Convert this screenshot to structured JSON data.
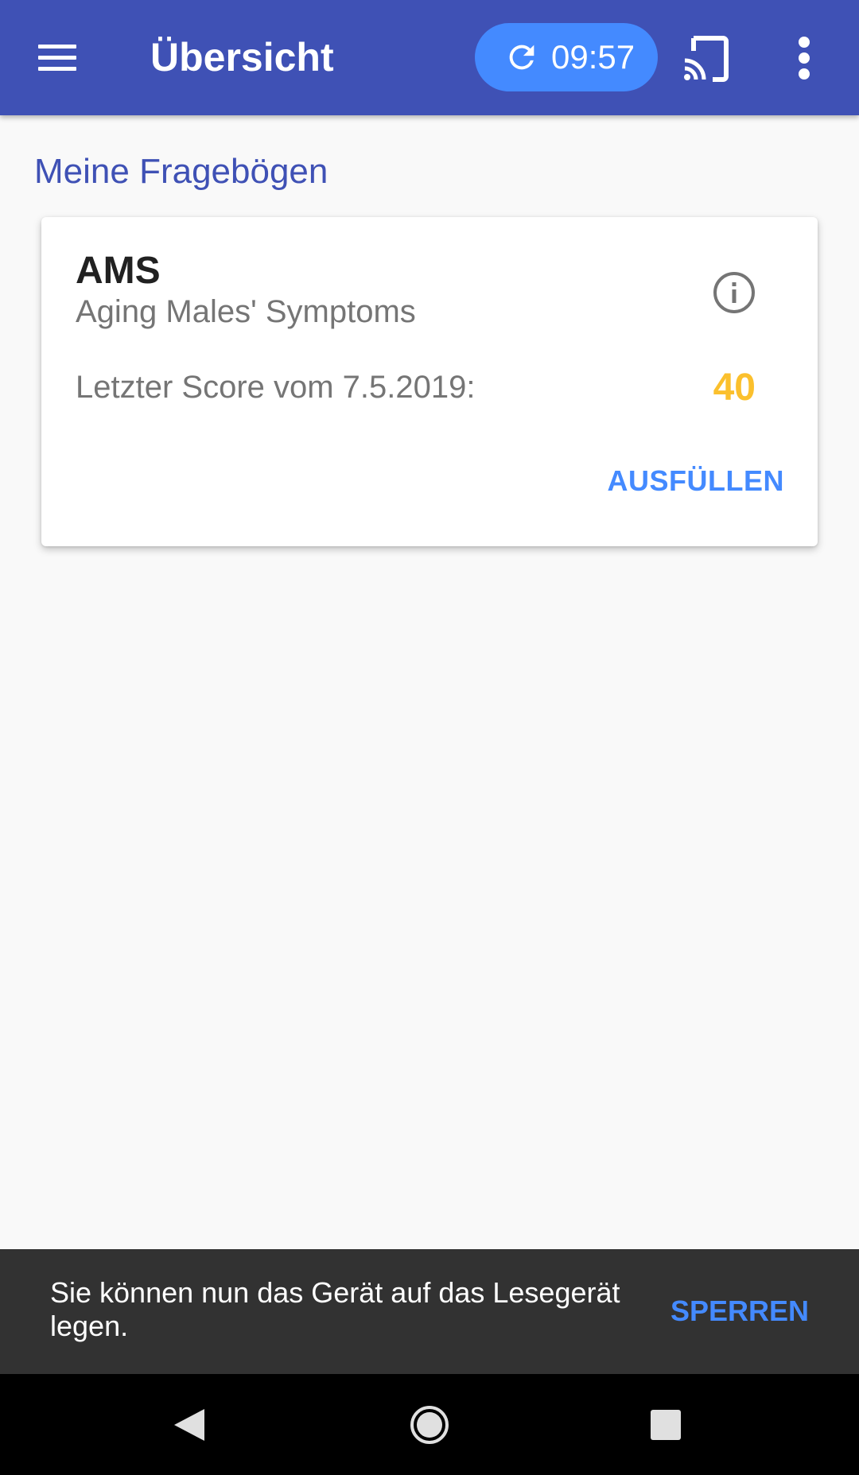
{
  "appbar": {
    "title": "Übersicht",
    "menu_icon": "hamburger-menu-icon",
    "sync": {
      "icon": "refresh-icon",
      "time": "09:57"
    },
    "cast_icon": "cast-icon",
    "overflow_icon": "more-vert-icon"
  },
  "main": {
    "section_title": "Meine Fragebögen",
    "questionnaires": [
      {
        "title": "AMS",
        "subtitle": "Aging Males' Symptoms",
        "info_icon": "info-icon",
        "score_label": "Letzter Score vom 7.5.2019:",
        "score_value": "40",
        "action_label": "AUSFÜLLEN"
      }
    ]
  },
  "snackbar": {
    "message": "Sie können nun das Gerät auf das Lesegerät legen.",
    "action_label": "SPERREN"
  },
  "navbar": {
    "back_icon": "back-icon",
    "home_icon": "home-icon",
    "recents_icon": "recents-icon"
  },
  "colors": {
    "primary": "#3f51b5",
    "accent": "#448aff",
    "score": "#fbc02d",
    "background": "#f9f9f9",
    "snackbar": "#323232"
  }
}
